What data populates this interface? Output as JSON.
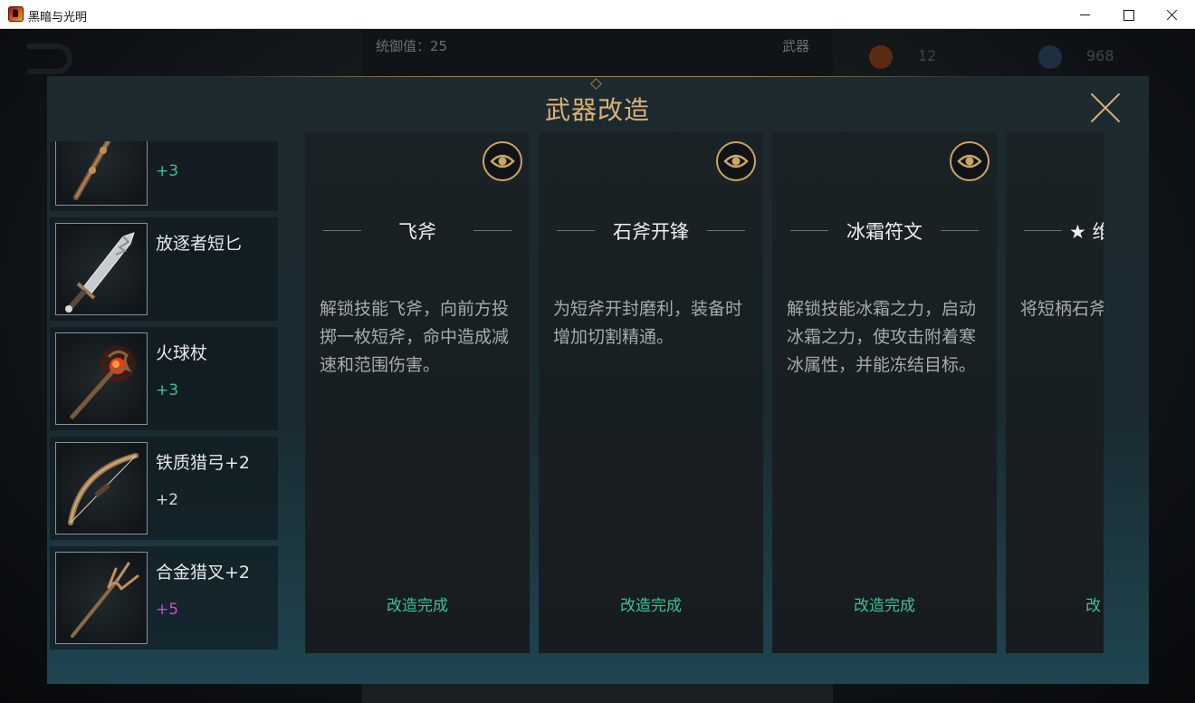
{
  "window": {
    "title": "黑暗与光明"
  },
  "background": {
    "stat_label": "统御值：25",
    "weapon_label": "武器",
    "resource_1": "12",
    "resource_2": "968"
  },
  "modal": {
    "title": "武器改造"
  },
  "items": [
    {
      "name": "",
      "level": "+3",
      "level_color": "green",
      "icon": "ornate-staff-icon"
    },
    {
      "name": "放逐者短匕",
      "level": "",
      "level_color": "white",
      "icon": "dagger-icon"
    },
    {
      "name": "火球杖",
      "level": "+3",
      "level_color": "green",
      "icon": "fireball-staff-icon"
    },
    {
      "name": "铁质猎弓+2",
      "level": "+2",
      "level_color": "white",
      "icon": "bow-icon"
    },
    {
      "name": "合金猎叉+2",
      "level": "+5",
      "level_color": "purple",
      "icon": "trident-icon"
    }
  ],
  "cards": [
    {
      "title": "飞斧",
      "description": "解锁技能飞斧，向前方投掷一枚短斧，命中造成减速和范围伤害。",
      "status": "改造完成"
    },
    {
      "title": "石斧开锋",
      "description": "为短斧开封磨利，装备时增加切割精通。",
      "status": "改造完成"
    },
    {
      "title": "冰霜符文",
      "description": "解锁技能冰霜之力，启动冰霜之力，使攻击附着寒冰属性，并能冻结目标。",
      "status": "改造完成"
    },
    {
      "title": "★ 维",
      "description": "将短柄石斧，大幅提力。",
      "status": "改"
    }
  ],
  "colors": {
    "gold": "#d9b175",
    "green": "#3fc190",
    "purple": "#c54fd6"
  }
}
